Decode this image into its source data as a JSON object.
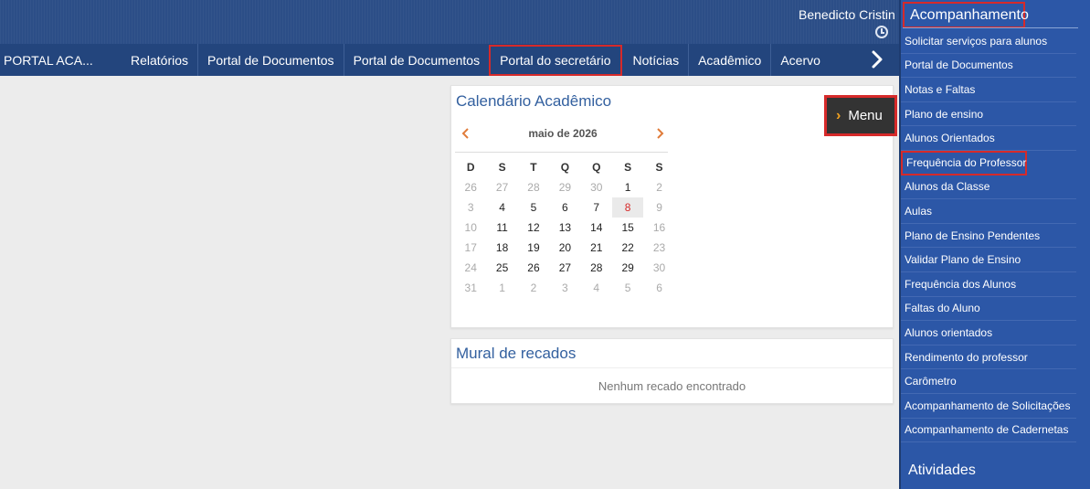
{
  "header": {
    "user_name": "Benedicto Cristin"
  },
  "nav": {
    "brand": "PORTAL ACA...",
    "items": [
      "Relatórios",
      "Portal de Documentos",
      "Portal de Documentos",
      "Portal do secretário",
      "Notícias",
      "Acadêmico",
      "Acervo"
    ]
  },
  "calendar": {
    "title": "Calendário Acadêmico",
    "month_label": "maio de 2026",
    "weekdays": [
      "D",
      "S",
      "T",
      "Q",
      "Q",
      "S",
      "S"
    ],
    "weeks": [
      [
        "26",
        "27",
        "28",
        "29",
        "30",
        "1",
        "2"
      ],
      [
        "3",
        "4",
        "5",
        "6",
        "7",
        "8",
        "9"
      ],
      [
        "10",
        "11",
        "12",
        "13",
        "14",
        "15",
        "16"
      ],
      [
        "17",
        "18",
        "19",
        "20",
        "21",
        "22",
        "23"
      ],
      [
        "24",
        "25",
        "26",
        "27",
        "28",
        "29",
        "30"
      ],
      [
        "31",
        "1",
        "2",
        "3",
        "4",
        "5",
        "6"
      ]
    ],
    "today": "8",
    "accent_color": "#e07b39"
  },
  "menu_button": {
    "label": "Menu"
  },
  "mural": {
    "title": "Mural de recados",
    "empty_text": "Nenhum recado encontrado"
  },
  "sidebar": {
    "heading": "Acompanhamento",
    "items": [
      "Solicitar serviços para alunos",
      "Portal de Documentos",
      "Notas e Faltas",
      "Plano de ensino",
      "Alunos Orientados",
      "Frequência do Professor",
      "Alunos da Classe",
      "Aulas",
      "Plano de Ensino Pendentes",
      "Validar Plano de Ensino",
      "Frequência dos Alunos",
      "Faltas do Aluno",
      "Alunos orientados",
      "Rendimento do professor",
      "Carômetro",
      "Acompanhamento de Solicitações",
      "Acompanhamento de Cadernetas"
    ],
    "heading_2": "Atividades"
  },
  "colors": {
    "topbar": "#2c4e87",
    "navbar": "#23457d",
    "sidebar": "#2c57a7",
    "highlight": "#d62a2a"
  }
}
